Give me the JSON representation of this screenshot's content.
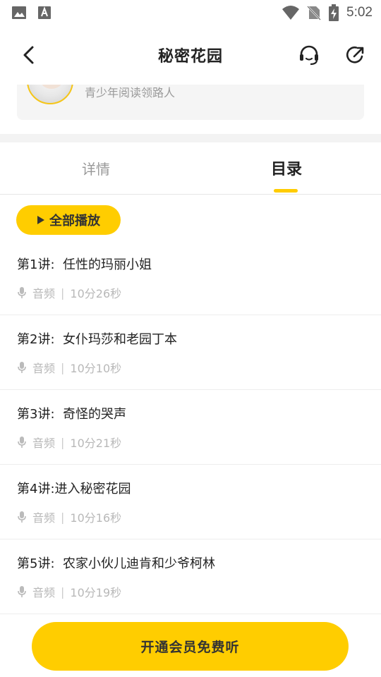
{
  "status_bar": {
    "time": "5:02",
    "icons": [
      "image-icon",
      "text-a-icon",
      "wifi-icon",
      "no-sim-icon",
      "battery-charging-icon"
    ]
  },
  "header": {
    "title": "秘密花园",
    "back_icon": "chevron-left-icon",
    "service_icon": "headset-icon",
    "share_icon": "share-icon"
  },
  "author": {
    "description": "青少年阅读领路人"
  },
  "tabs": [
    {
      "label": "详情",
      "active": false
    },
    {
      "label": "目录",
      "active": true
    }
  ],
  "play_all": {
    "label": "全部播放"
  },
  "episodes": [
    {
      "title": "第1讲:  任性的玛丽小姐",
      "type": "音频",
      "duration": "10分26秒"
    },
    {
      "title": "第2讲:  女仆玛莎和老园丁本",
      "type": "音频",
      "duration": "10分10秒"
    },
    {
      "title": "第3讲:  奇怪的哭声",
      "type": "音频",
      "duration": "10分21秒"
    },
    {
      "title": "第4讲:进入秘密花园",
      "type": "音频",
      "duration": "10分16秒"
    },
    {
      "title": "第5讲:  农家小伙儿迪肯和少爷柯林",
      "type": "音频",
      "duration": "10分19秒"
    }
  ],
  "meta_separator": "|",
  "cta": {
    "label": "开通会员免费听"
  },
  "colors": {
    "accent": "#ffcd00",
    "muted_text": "#b8b8b8",
    "primary_text": "#222222"
  }
}
